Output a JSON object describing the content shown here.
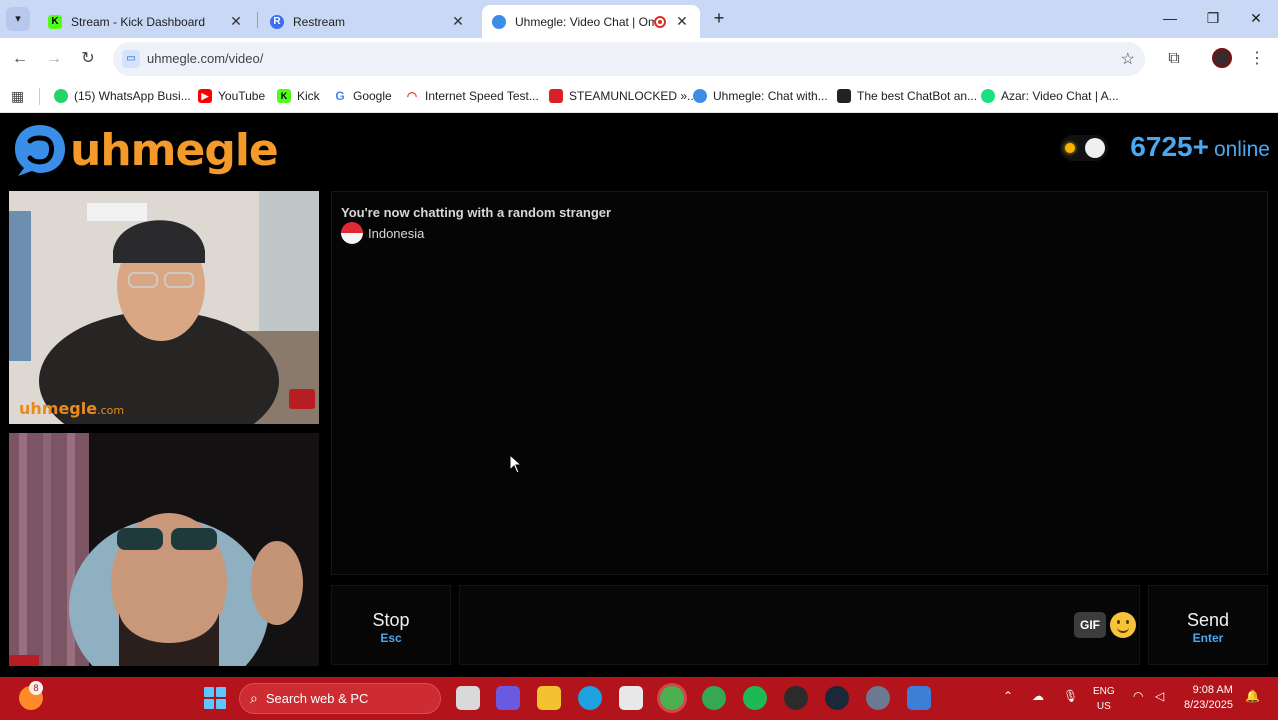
{
  "browser": {
    "tabs": [
      {
        "title": "Stream - Kick Dashboard",
        "favicon": "kick-favicon",
        "color": "#53fc18"
      },
      {
        "title": "Restream",
        "favicon": "restream-favicon",
        "color": "#3e6ff0"
      },
      {
        "title": "Uhmegle: Video Chat | Ome",
        "favicon": "uhmegle-favicon",
        "color": "#3b8ee8",
        "recording": true
      }
    ],
    "url": "uhmegle.com/video/",
    "bookmarks": [
      {
        "label": "(15) WhatsApp Busi...",
        "icon": "whatsapp-icon",
        "color": "#25d366"
      },
      {
        "label": "YouTube",
        "icon": "youtube-icon",
        "color": "#ff0000"
      },
      {
        "label": "Kick",
        "icon": "kick-icon",
        "color": "#53fc18"
      },
      {
        "label": "Google",
        "icon": "google-icon",
        "color": "#4285f4"
      },
      {
        "label": "Internet Speed Test...",
        "icon": "speedtest-icon",
        "color": "#e9463b"
      },
      {
        "label": "STEAMUNLOCKED »...",
        "icon": "steamunlocked-icon",
        "color": "#d61f26"
      },
      {
        "label": "Uhmegle: Chat with...",
        "icon": "uhmegle-icon",
        "color": "#3b8ee8"
      },
      {
        "label": "The best ChatBot an...",
        "icon": "chatbot-icon",
        "color": "#222222"
      },
      {
        "label": "Azar: Video Chat | A...",
        "icon": "azar-icon",
        "color": "#19e27f"
      }
    ]
  },
  "site": {
    "logo": "uhmegle",
    "brand_color": "#f39a2b",
    "accent_color": "#4aa7f0",
    "online_count": "6725+",
    "online_label": "online"
  },
  "chat": {
    "status": "You're now chatting with a random stranger",
    "country": "Indonesia",
    "stranger_watermark": "uhmegle",
    "stranger_watermark_suffix": ".com",
    "stop_label": "Stop",
    "stop_key": "Esc",
    "gif_label": "GIF",
    "send_label": "Send",
    "send_key": "Enter",
    "message_value": ""
  },
  "taskbar": {
    "widget_badge": "8",
    "search_placeholder": "Search web & PC",
    "lang_line1": "ENG",
    "lang_line2": "US",
    "time": "9:08 AM",
    "date": "8/23/2025"
  }
}
